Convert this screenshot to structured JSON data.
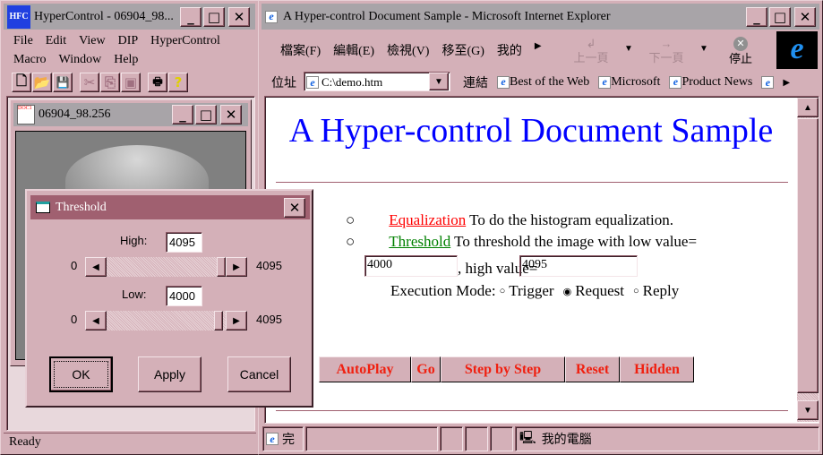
{
  "left_window": {
    "title": "HyperControl - 06904_98...",
    "menu": [
      "File",
      "Edit",
      "View",
      "DIP",
      "HyperControl",
      "Macro",
      "Window",
      "Help"
    ],
    "toolbar_icons": [
      "new-icon",
      "open-icon",
      "save-icon",
      "cut-icon",
      "copy-icon",
      "paste-icon",
      "print-icon",
      "help-icon"
    ],
    "child_title": "06904_98.256",
    "status": "Ready"
  },
  "dialog": {
    "title": "Threshold",
    "high_label": "High:",
    "high_value": "4095",
    "low_label": "Low:",
    "low_value": "4000",
    "min": "0",
    "max": "4095",
    "high_slider_fraction": 1.0,
    "low_slider_fraction": 0.977,
    "ok": "OK",
    "apply": "Apply",
    "cancel": "Cancel"
  },
  "ie": {
    "title": "A Hyper-control Document Sample - Microsoft Internet Explorer",
    "menu": [
      "檔案(F)",
      "編輯(E)",
      "檢視(V)",
      "移至(G)",
      "我的"
    ],
    "back": "上一頁",
    "forward": "下一頁",
    "stop": "停止",
    "address_label": "位址",
    "address": "C:\\demo.htm",
    "links_label": "連結",
    "links": [
      "Best of the Web",
      "Microsoft",
      "Product News"
    ],
    "status_text": "完",
    "zone": "我的電腦"
  },
  "page": {
    "heading": "A Hyper-control Document Sample",
    "item1_link": "Equalization",
    "item1_text": "To do the histogram equalization.",
    "item2_link": "Threshold",
    "item2_text": "To threshold the image with low value=",
    "low_value": "4000",
    "high_label": ", high value=",
    "high_value": "4095",
    "mode_label": "Execution Mode:",
    "modes": [
      "Trigger",
      "Request",
      "Reply"
    ],
    "selected_mode": "Request",
    "buttons": [
      "AutoPlay",
      "Go",
      "Step by Step",
      "Reset",
      "Hidden"
    ],
    "colors": {
      "heading": "#0000ff",
      "link1": "#ff0000",
      "link2": "#008000",
      "buttons": "#f02010"
    }
  }
}
